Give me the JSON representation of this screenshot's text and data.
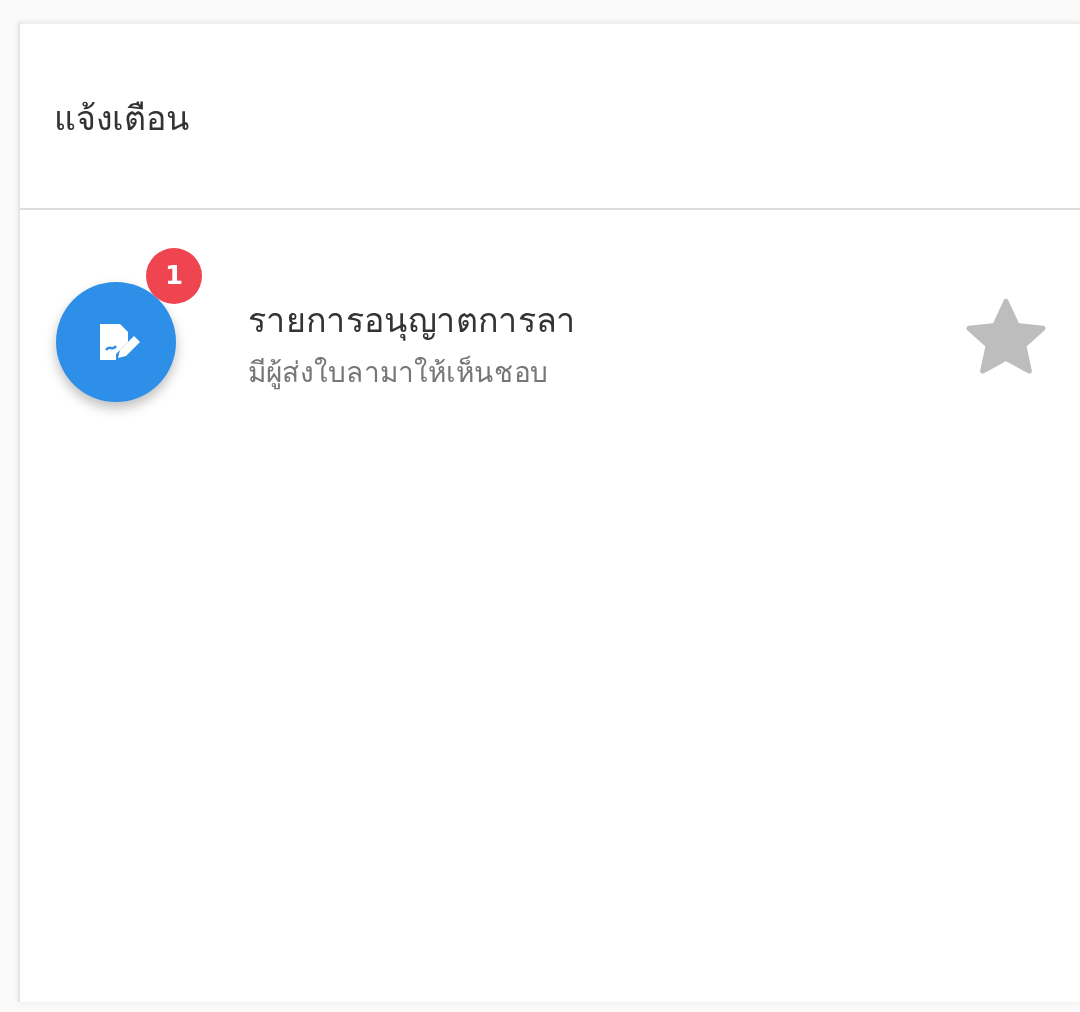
{
  "panel": {
    "title": "แจ้งเตือน"
  },
  "notifications": [
    {
      "title": "รายการอนุญาตการลา",
      "subtitle": "มีผู้ส่งใบลามาให้เห็นชอบ",
      "badge": "1",
      "starred": false
    }
  ]
}
